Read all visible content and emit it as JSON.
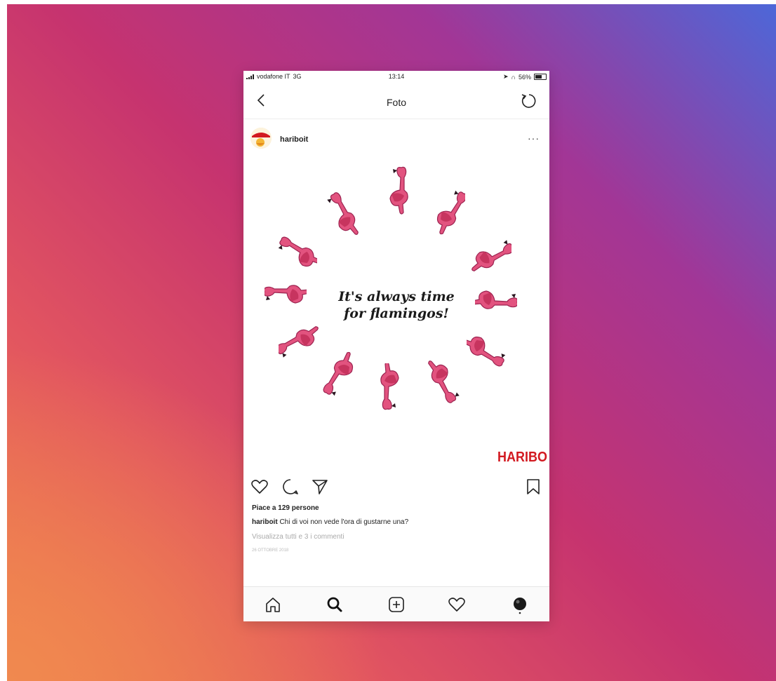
{
  "status_bar": {
    "carrier": "vodafone IT",
    "network": "3G",
    "time": "13:14",
    "battery": "56%"
  },
  "nav": {
    "title": "Foto"
  },
  "post": {
    "username": "hariboit",
    "more_label": "···",
    "image_text_line1": "It's always time",
    "image_text_line2": "for flamingos!",
    "brand_logo": "HARIBO",
    "likes": "Piace a 129 persone",
    "caption_user": "hariboit",
    "caption_text": " Chi di voi non vede l'ora di gustarne una?",
    "view_comments": "Visualizza tutti e 3 i commenti",
    "date": "26 ottobre 2018"
  },
  "icons": {
    "back": "chevron-left-icon",
    "refresh": "refresh-icon",
    "like": "heart-icon",
    "comment": "comment-icon",
    "share": "send-icon",
    "save": "bookmark-icon",
    "home": "home-icon",
    "search": "search-icon",
    "add": "add-post-icon",
    "activity": "heart-icon",
    "profile": "profile-avatar"
  },
  "colors": {
    "flamingo_pink": "#e2537f",
    "haribo_red": "#d21920",
    "gradient_start": "#f07b4e",
    "gradient_end": "#4d67d8"
  }
}
